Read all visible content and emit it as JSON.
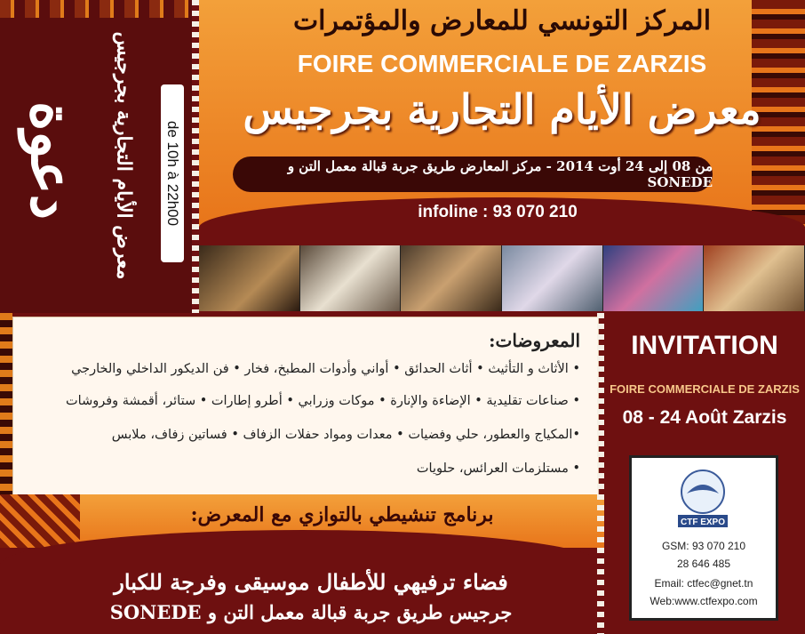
{
  "stub": {
    "title": "دعوة",
    "subtitle": "معرض الأيام التجارية بجرجيس",
    "hours": "de 10h à 22h00"
  },
  "header": {
    "arabic_org": "المركز التونسي للمعارض والمؤتمرات",
    "french_title": "FOIRE COMMERCIALE DE ZARZIS",
    "arabic_title": "معرض الأيام التجارية بجرجيس",
    "dates_location": "من 08 إلى 24 أوت 2014 - مركز المعارض طريق جربة قبالة معمل التن و SONEDE",
    "infoline": "infoline : 93 070 210"
  },
  "exhibits": {
    "title": "المعروضات:",
    "lines": [
      "• الأثاث و التأثيث • أثاث الحدائق • أواني وأدوات المطبخ، فخار • فن الديكور الداخلي والخارجي",
      "• صناعات تقليدية • الإضاءة والإنارة • موكات وزرابي • أطرو إطارات • ستائر، أقمشة وفروشات",
      "•المكياج والعطور، حلي وفضيات • معدات ومواد حفلات الزفاف • فساتين زفاف، ملابس",
      "• مستلزمات العرائس، حلويات"
    ]
  },
  "program": "برنامج تنشيطي بالتوازي مع المعرض:",
  "footer": {
    "line1": "فضاء ترفيهي للأطفال موسيقى وفرجة للكبار",
    "line2": "جرجيس طريق جربة قبالة معمل التن و SONEDE"
  },
  "invitation": {
    "title": "INVITATION",
    "subtitle": "FOIRE COMMERCIALE DE ZARZIS",
    "date": "08 - 24 Août Zarzis"
  },
  "contact": {
    "logo_text": "CTF EXPO",
    "gsm": "GSM: 93 070 210",
    "gsm2": "28 646 485",
    "email": "Email: ctfec@gnet.tn",
    "web": "Web:www.ctfexpo.com"
  },
  "colors": {
    "maroon": "#6e1010",
    "orange": "#e8751a"
  }
}
